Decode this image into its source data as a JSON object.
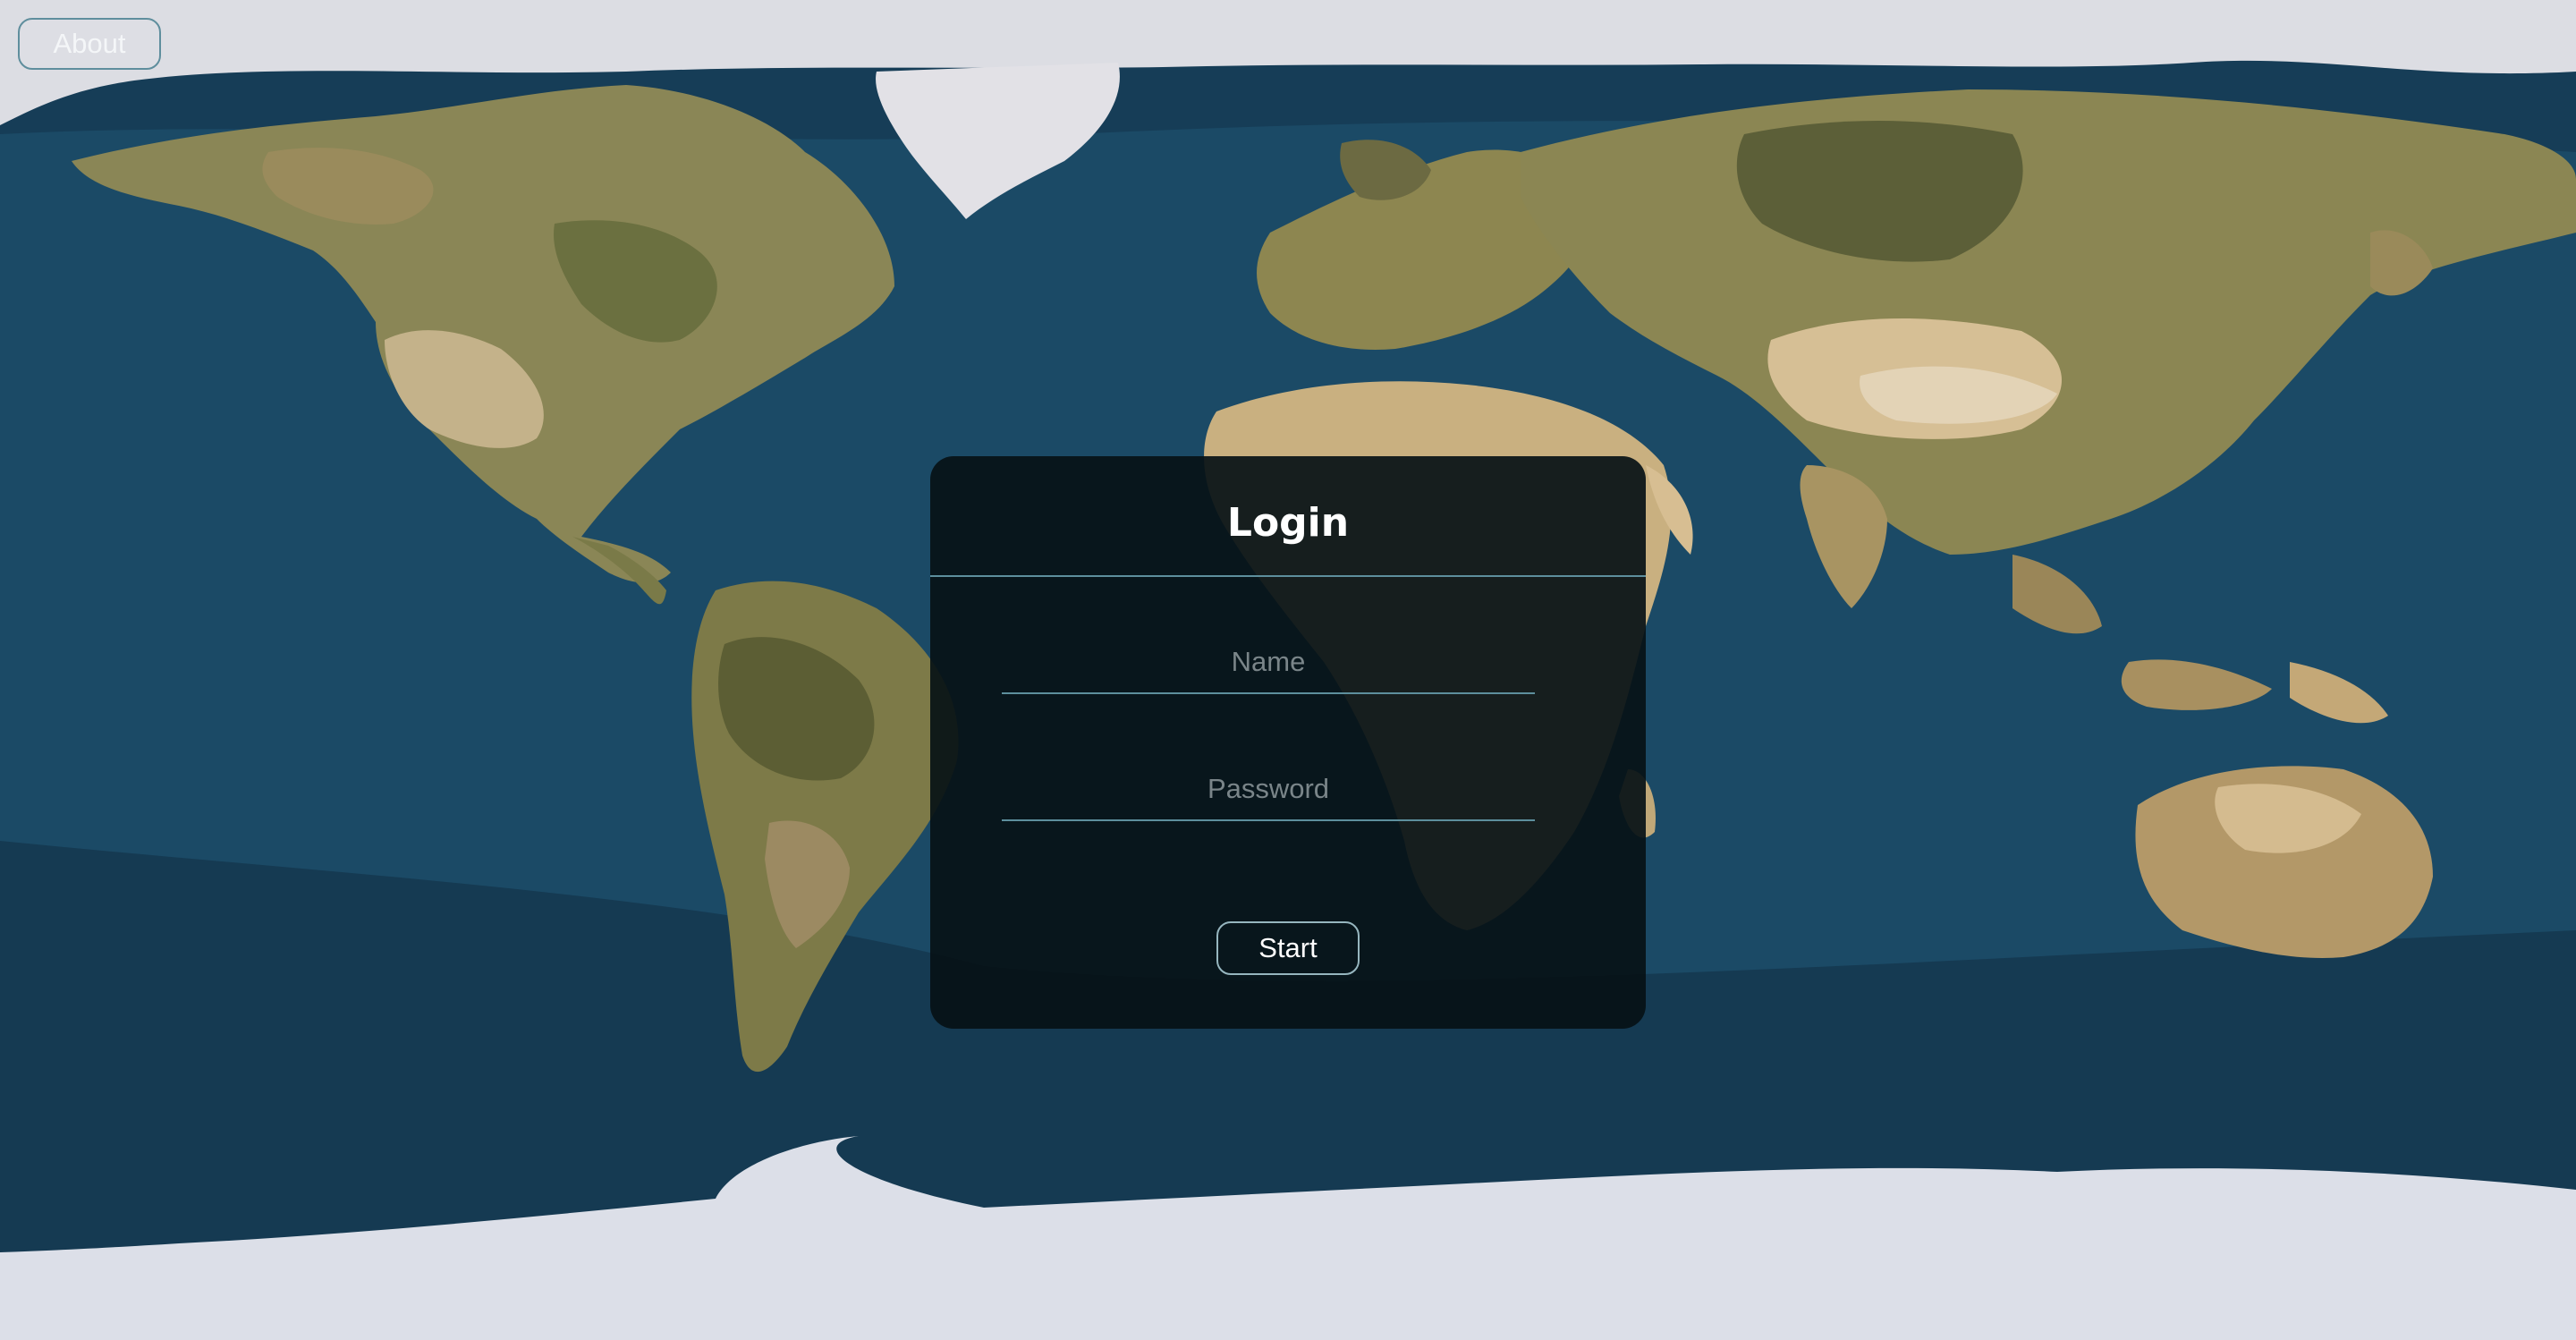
{
  "header": {
    "about_label": "About"
  },
  "login": {
    "title": "Login",
    "name_placeholder": "Name",
    "password_placeholder": "Password",
    "start_label": "Start"
  },
  "background": {
    "icon": "world-map",
    "colors": {
      "ocean": "#1b4a66",
      "deep_ocean": "#153a52",
      "ice": "#dfe0e8",
      "land_olive": "#8a8a56",
      "land_dark": "#5c5e3a",
      "land_tan": "#c8ad80"
    }
  },
  "colors": {
    "card": "#061116",
    "accent_line": "#5d8f9d",
    "text": "#ffffff",
    "placeholder": "#7a8589"
  }
}
